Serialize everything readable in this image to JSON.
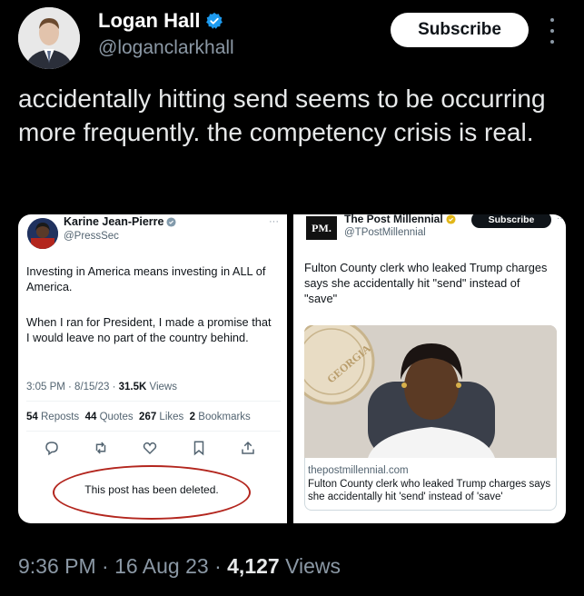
{
  "author": {
    "name": "Logan Hall",
    "handle": "@loganclarkhall",
    "verified_icon": "verified-badge-icon"
  },
  "subscribe_label": "Subscribe",
  "tweet": {
    "text": "accidentally hitting send seems to be occurring more frequently. the competency crisis is real."
  },
  "embedded_left": {
    "name": "Karine Jean-Pierre",
    "handle": "@PressSec",
    "body1": "Investing in America means investing in ALL of America.",
    "body2": "When I ran for President, I made a promise that I would leave no part of the country behind.",
    "time": "3:05 PM · 8/15/23 · ",
    "views_count": "31.5K",
    "views_label": " Views",
    "reposts_count": "54",
    "reposts_label": " Reposts",
    "quotes_count": "44",
    "quotes_label": " Quotes",
    "likes_count": "267",
    "likes_label": " Likes",
    "bookmarks_count": "2",
    "bookmarks_label": " Bookmarks",
    "deleted_text": "This post has been deleted."
  },
  "embedded_right": {
    "logo_text": "PM.",
    "name": "The Post Millennial",
    "handle": "@TPostMillennial",
    "subscribe_label": "Subscribe",
    "body": "Fulton County clerk who leaked Trump charges says she accidentally hit \"send\" instead of \"save\"",
    "seal_text": "GEORGIA",
    "domain": "thepostmillennial.com",
    "caption": "Fulton County clerk who leaked Trump charges says she accidentally hit 'send' instead of 'save'"
  },
  "footer": {
    "time": "9:36 PM · 16 Aug 23 · ",
    "views_count": "4,127",
    "views_label": " Views"
  },
  "colors": {
    "background": "#000000",
    "verified": "#1d9bf0",
    "deleted_circle": "#b3261e"
  }
}
